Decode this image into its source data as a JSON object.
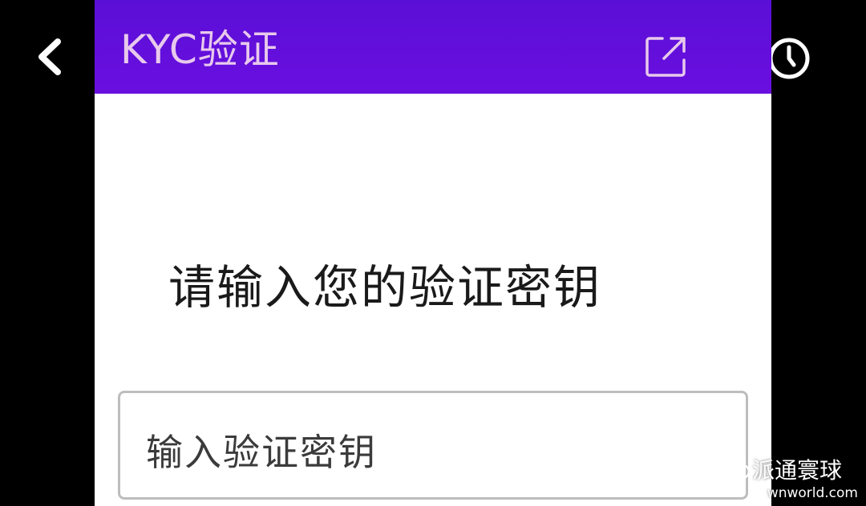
{
  "header": {
    "title": "KYC验证",
    "open_icon": "external-link-icon",
    "background": "#5a0fd6",
    "title_color": "#e8c9ec"
  },
  "nav": {
    "back_icon": "chevron-left-icon",
    "history_icon": "clock-icon"
  },
  "main": {
    "heading": "请输入您的验证密钥",
    "key_input": {
      "placeholder": "输入验证密钥",
      "value": ""
    }
  },
  "watermark": {
    "name": "派通寰球",
    "url": "wnworld.com",
    "icon": "wechat-icon"
  }
}
